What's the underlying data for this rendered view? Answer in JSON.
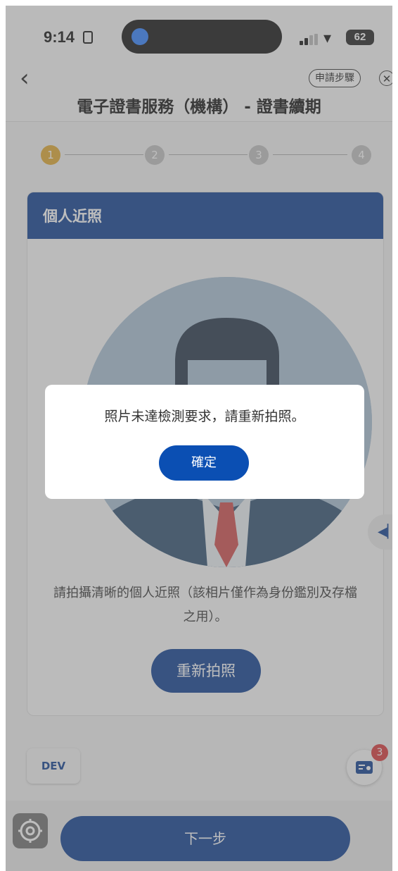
{
  "status_bar": {
    "time": "9:14",
    "battery": "62"
  },
  "header": {
    "back_icon": "chevron-left-icon",
    "steps_label": "申請步驟",
    "close_icon": "close-circle-icon",
    "title": "電子證書服務（機構） - 證書續期"
  },
  "stepper": {
    "steps": [
      "1",
      "2",
      "3",
      "4"
    ],
    "active_color": "#e0a82e",
    "inactive_color": "#bfbfbf"
  },
  "card": {
    "title": "個人近照",
    "description": "請拍攝清晰的個人近照（該相片僅作為身份鑑別及存檔之用）。",
    "retake_label": "重新拍照"
  },
  "dev_label": "DEV",
  "notification_badge": "3",
  "next_label": "下一步",
  "dialog": {
    "message": "照片未達檢測要求，請重新拍照。",
    "confirm_label": "確定"
  },
  "colors": {
    "brand": "#0b3d91",
    "accent": "#e0a82e",
    "badge": "#d9383a"
  }
}
